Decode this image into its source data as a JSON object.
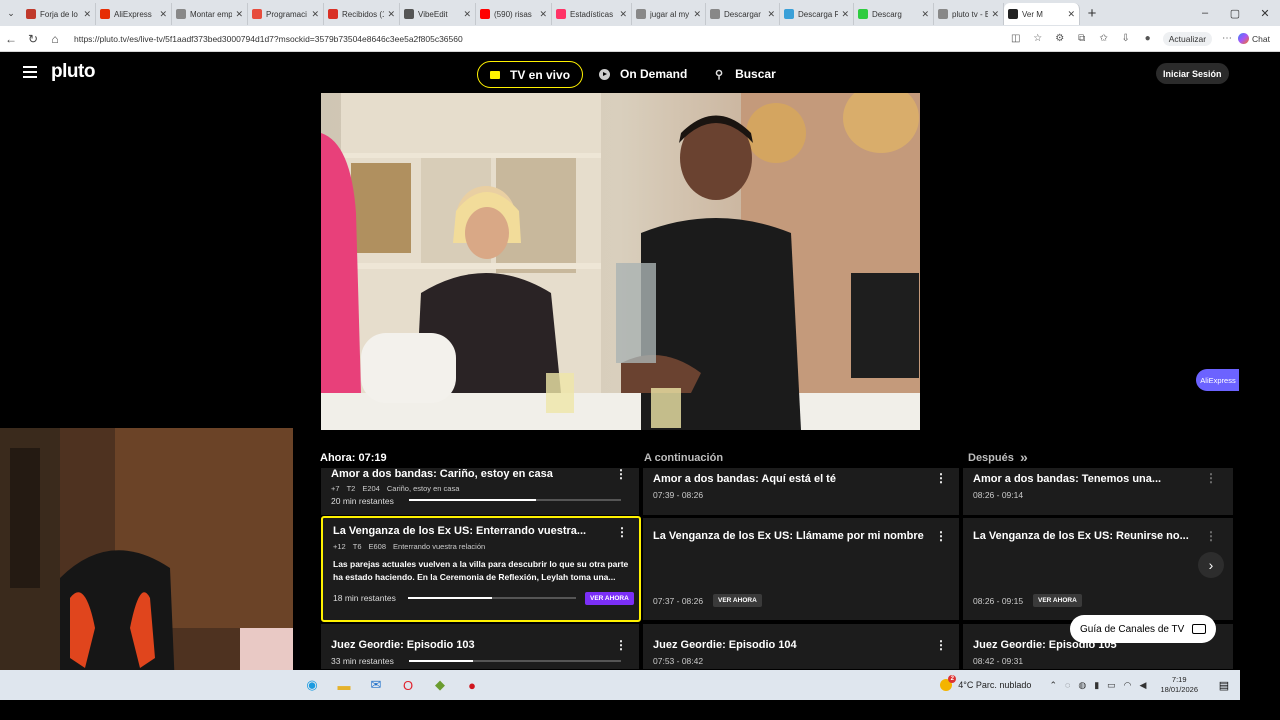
{
  "browser": {
    "tabs": [
      {
        "title": "Forja de lo",
        "favicon_color": "#c0392b"
      },
      {
        "title": "AliExpress",
        "favicon_color": "#e62e04"
      },
      {
        "title": "Montar emp",
        "favicon_color": "#888888"
      },
      {
        "title": "Programaci",
        "favicon_color": "#e74c3c"
      },
      {
        "title": "Recibidos (1",
        "favicon_color": "#d93025"
      },
      {
        "title": "VibeEdit",
        "favicon_color": "#555555"
      },
      {
        "title": "(590) risas",
        "favicon_color": "#ff0000"
      },
      {
        "title": "Estadísticas",
        "favicon_color": "#ff3366"
      },
      {
        "title": "jugar al my",
        "favicon_color": "#888888"
      },
      {
        "title": "Descargar",
        "favicon_color": "#888888"
      },
      {
        "title": "Descarga R",
        "favicon_color": "#3aa0d8"
      },
      {
        "title": "Descarg",
        "favicon_color": "#2ecc40"
      },
      {
        "title": "pluto tv - B",
        "favicon_color": "#888888"
      },
      {
        "title": "Ver M",
        "favicon_color": "#222222",
        "active": true
      }
    ],
    "url": "https://pluto.tv/es/live-tv/5f1aadf373bed3000794d1d7?msockid=3579b73504e8646c3ee5a2f805c36560",
    "update_label": "Actualizar",
    "chat_label": "Chat"
  },
  "pluto": {
    "logo": "pluto",
    "nav": {
      "tv_live": "TV en vivo",
      "on_demand": "On Demand",
      "search": "Buscar",
      "login": "Iniciar Sesión"
    },
    "aliexpress_pill": "AliExpress",
    "guide": {
      "now_label": "Ahora: 07:19",
      "next_label": "A continuación",
      "later_label": "Después",
      "rows": [
        {
          "current": {
            "title": "Amor a dos bandas: Cariño, estoy en casa",
            "rating": "+7",
            "season": "T2",
            "episode": "E204",
            "ep_title": "Cariño, estoy en casa",
            "remaining": "20 min restantes",
            "progress": 0.6
          },
          "next": {
            "title": "Amor a dos bandas: Aquí está el té",
            "time": "07:39 - 08:26"
          },
          "later": {
            "title": "Amor a dos bandas: Tenemos una...",
            "time": "08:26 - 09:14"
          }
        },
        {
          "current": {
            "title": "La Venganza de los Ex US: Enterrando vuestra...",
            "rating": "+12",
            "season": "T6",
            "episode": "E608",
            "ep_title": "Enterrando vuestra relación",
            "description": "Las parejas actuales vuelven a la villa para descubrir lo que su otra parte ha estado haciendo. En la Ceremonia de Reflexión, Leylah toma una...",
            "remaining": "18 min restantes",
            "progress": 0.5,
            "watch": "VER AHORA"
          },
          "next": {
            "title": "La Venganza de los Ex US: Llámame por mi nombre",
            "time": "07:37 - 08:26",
            "watch": "VER AHORA"
          },
          "later": {
            "title": "La Venganza de los Ex US: Reunirse no...",
            "time": "08:26 - 09:15",
            "watch": "VER AHORA"
          }
        },
        {
          "current": {
            "title": "Juez Geordie: Episodio 103",
            "remaining": "33 min restantes",
            "progress": 0.3
          },
          "next": {
            "title": "Juez Geordie: Episodio 104",
            "time": "07:53 - 08:42"
          },
          "later": {
            "title": "Juez Geordie: Episodio 105",
            "time": "08:42 - 09:31"
          }
        }
      ],
      "channels_guide_button": "Guía de Canales de TV"
    }
  },
  "taskbar": {
    "weather": "4°C  Parc. nublado",
    "weather_badge": "2",
    "time": "7:19",
    "date": "18/01/2026"
  },
  "colors": {
    "accent_yellow": "#fff200",
    "watch_purple": "#7b2ff7",
    "cell_bg": "#1c1c1c"
  }
}
